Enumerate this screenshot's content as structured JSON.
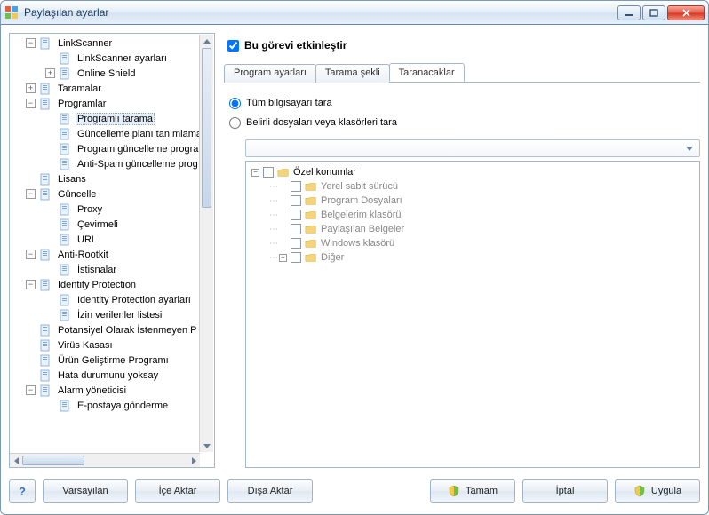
{
  "window": {
    "title": "Paylaşılan ayarlar"
  },
  "task_enable": {
    "label": "Bu görevi etkinleştir",
    "checked": true
  },
  "tabs": [
    {
      "label": "Program ayarları",
      "active": false
    },
    {
      "label": "Tarama şekli",
      "active": false
    },
    {
      "label": "Taranacaklar",
      "active": true
    }
  ],
  "radios": [
    {
      "label": "Tüm bilgisayarı tara",
      "checked": true
    },
    {
      "label": "Belirli dosyaları veya klasörleri tara",
      "checked": false
    }
  ],
  "inner_tree": {
    "root": {
      "label": "Özel konumlar",
      "exp": "-"
    },
    "children": [
      {
        "label": "Yerel sabit sürücü"
      },
      {
        "label": "Program Dosyaları"
      },
      {
        "label": "Belgelerim klasörü"
      },
      {
        "label": "Paylaşılan Belgeler"
      },
      {
        "label": "Windows klasörü"
      },
      {
        "label": "Diğer",
        "exp": "+"
      }
    ]
  },
  "tree": [
    {
      "ind": 1,
      "exp": "-",
      "ico": "page",
      "label": "LinkScanner"
    },
    {
      "ind": 2,
      "exp": "",
      "ico": "page",
      "label": "LinkScanner ayarları"
    },
    {
      "ind": 2,
      "exp": "+",
      "ico": "page",
      "label": "Online Shield"
    },
    {
      "ind": 1,
      "exp": "+",
      "ico": "page",
      "label": "Taramalar"
    },
    {
      "ind": 1,
      "exp": "-",
      "ico": "page",
      "label": "Programlar"
    },
    {
      "ind": 2,
      "exp": "",
      "ico": "page",
      "label": "Programlı tarama",
      "sel": true
    },
    {
      "ind": 2,
      "exp": "",
      "ico": "page",
      "label": "Güncelleme planı tanımlamal"
    },
    {
      "ind": 2,
      "exp": "",
      "ico": "page",
      "label": "Program güncelleme progra"
    },
    {
      "ind": 2,
      "exp": "",
      "ico": "page",
      "label": "Anti-Spam güncelleme prog"
    },
    {
      "ind": 1,
      "exp": "",
      "ico": "page",
      "label": "Lisans"
    },
    {
      "ind": 1,
      "exp": "-",
      "ico": "page",
      "label": "Güncelle"
    },
    {
      "ind": 2,
      "exp": "",
      "ico": "page",
      "label": "Proxy"
    },
    {
      "ind": 2,
      "exp": "",
      "ico": "page",
      "label": "Çevirmeli"
    },
    {
      "ind": 2,
      "exp": "",
      "ico": "page",
      "label": "URL"
    },
    {
      "ind": 1,
      "exp": "-",
      "ico": "page",
      "label": "Anti-Rootkit"
    },
    {
      "ind": 2,
      "exp": "",
      "ico": "page",
      "label": "İstisnalar"
    },
    {
      "ind": 1,
      "exp": "-",
      "ico": "page",
      "label": "Identity Protection"
    },
    {
      "ind": 2,
      "exp": "",
      "ico": "page",
      "label": "Identity Protection ayarları"
    },
    {
      "ind": 2,
      "exp": "",
      "ico": "page",
      "label": "İzin verilenler listesi"
    },
    {
      "ind": 1,
      "exp": "",
      "ico": "page",
      "label": "Potansiyel Olarak İstenmeyen P"
    },
    {
      "ind": 1,
      "exp": "",
      "ico": "page",
      "label": "Virüs Kasası"
    },
    {
      "ind": 1,
      "exp": "",
      "ico": "page",
      "label": "Ürün Geliştirme Programı"
    },
    {
      "ind": 1,
      "exp": "",
      "ico": "page",
      "label": "Hata durumunu yoksay"
    },
    {
      "ind": 1,
      "exp": "-",
      "ico": "page",
      "label": "Alarm yöneticisi"
    },
    {
      "ind": 2,
      "exp": "",
      "ico": "page",
      "label": "E-postaya gönderme"
    }
  ],
  "buttons": {
    "help_tip": "?",
    "defaults": "Varsayılan",
    "import": "İçe Aktar",
    "export": "Dışa Aktar",
    "ok": "Tamam",
    "cancel": "İptal",
    "apply": "Uygula"
  }
}
